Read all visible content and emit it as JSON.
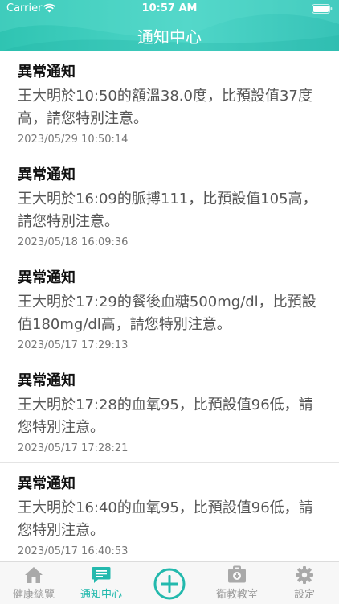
{
  "status_bar": {
    "carrier": "Carrier",
    "time": "10:57 AM"
  },
  "header": {
    "title": "通知中心"
  },
  "notifications": [
    {
      "title": "異常通知",
      "message": "王大明於10:50的額溫38.0度，比預設值37度高，請您特別注意。",
      "time": "2023/05/29 10:50:14"
    },
    {
      "title": "異常通知",
      "message": "王大明於16:09的脈搏111，比預設值105高，請您特別注意。",
      "time": "2023/05/18 16:09:36"
    },
    {
      "title": "異常通知",
      "message": "王大明於17:29的餐後血糖500mg/dl，比預設值180mg/dl高，請您特別注意。",
      "time": "2023/05/17 17:29:13"
    },
    {
      "title": "異常通知",
      "message": "王大明於17:28的血氧95，比預設值96低，請您特別注意。",
      "time": "2023/05/17 17:28:21"
    },
    {
      "title": "異常通知",
      "message": "王大明於16:40的血氧95，比預設值96低，請您特別注意。",
      "time": "2023/05/17 16:40:53"
    }
  ],
  "tabbar": {
    "items": [
      {
        "label": "健康總覽",
        "icon": "home-icon"
      },
      {
        "label": "通知中心",
        "icon": "chat-icon",
        "active": true
      },
      {
        "label": "",
        "icon": "add-circle-icon"
      },
      {
        "label": "衛教教室",
        "icon": "medical-kit-icon"
      },
      {
        "label": "設定",
        "icon": "gear-icon"
      }
    ]
  },
  "colors": {
    "accent": "#23b9ad",
    "header_start": "#2fc4b2",
    "header_end": "#37c3b7",
    "inactive": "#9a9a9a"
  }
}
